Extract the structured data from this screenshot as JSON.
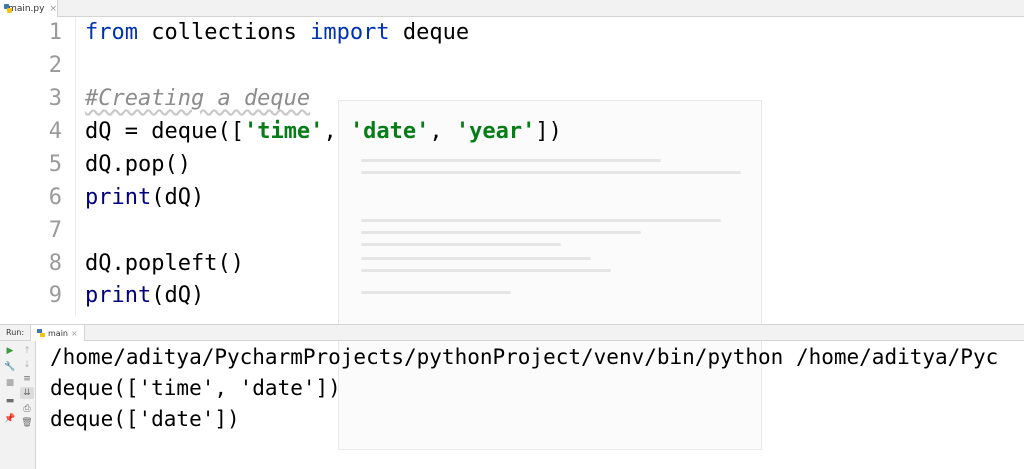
{
  "editor": {
    "tab": {
      "filename": "main.py",
      "close": "×"
    },
    "lines": [
      {
        "no": "1"
      },
      {
        "no": "2"
      },
      {
        "no": "3"
      },
      {
        "no": "4"
      },
      {
        "no": "5"
      },
      {
        "no": "6"
      },
      {
        "no": "7"
      },
      {
        "no": "8"
      },
      {
        "no": "9"
      }
    ],
    "code": {
      "l1": {
        "kw1": "from",
        "mod": " collections ",
        "kw2": "import",
        "name": " deque"
      },
      "l3": {
        "comment": "#Creating a deque"
      },
      "l4": {
        "pre": "dQ = deque([",
        "s1": "'time'",
        "c1": ", ",
        "s2": "'date'",
        "c2": ", ",
        "s3": "'year'",
        "post": "])"
      },
      "l5": {
        "text": "dQ.pop()"
      },
      "l6": {
        "fn": "print",
        "args": "(dQ)"
      },
      "l8": {
        "text": "dQ.popleft()"
      },
      "l9": {
        "fn": "print",
        "args": "(dQ)"
      }
    }
  },
  "run": {
    "label": "Run:",
    "tab": "main",
    "tab_close": "×",
    "output": [
      "/home/aditya/PycharmProjects/pythonProject/venv/bin/python /home/aditya/Pyc",
      "deque(['time', 'date'])",
      "deque(['date'])"
    ],
    "toolbar_icons": [
      "run-icon",
      "wrench-icon",
      "stop-icon",
      "layout-icon",
      "pin-icon",
      "up-arrow-icon",
      "down-arrow-icon",
      "soft-wrap-icon",
      "scroll-to-end-icon",
      "print-icon",
      "trash-icon"
    ]
  },
  "colors": {
    "keyword": "#0033b3",
    "builtin": "#000080",
    "string": "#067d17",
    "comment": "#8c8c8c",
    "line_number": "#9a9a9a"
  }
}
